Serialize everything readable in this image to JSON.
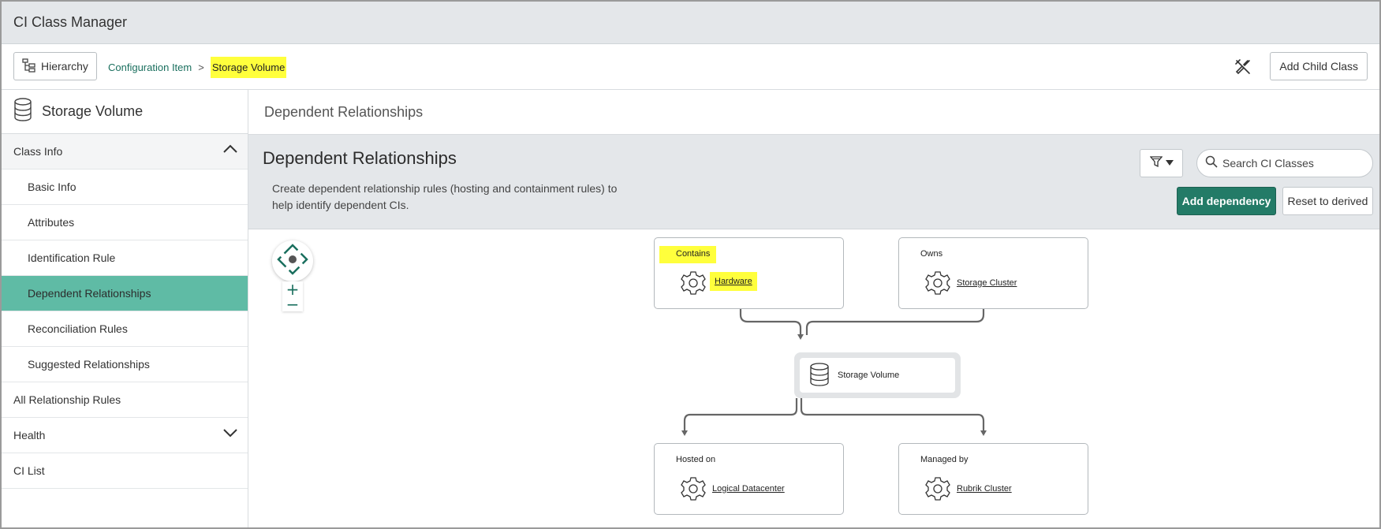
{
  "app": {
    "title": "CI Class Manager"
  },
  "toolbar": {
    "hierarchy_label": "Hierarchy",
    "breadcrumb": {
      "parent": "Configuration Item",
      "separator": ">",
      "current": "Storage Volume"
    },
    "add_child_label": "Add Child Class"
  },
  "sidebar": {
    "class_name": "Storage Volume",
    "items": [
      {
        "label": "Class Info"
      },
      {
        "label": "Basic Info"
      },
      {
        "label": "Attributes"
      },
      {
        "label": "Identification Rule"
      },
      {
        "label": "Dependent Relationships"
      },
      {
        "label": "Reconciliation Rules"
      },
      {
        "label": "Suggested Relationships"
      },
      {
        "label": "All Relationship Rules"
      },
      {
        "label": "Health"
      },
      {
        "label": "CI List"
      }
    ]
  },
  "main": {
    "page_title": "Dependent Relationships",
    "panel": {
      "title": "Dependent Relationships",
      "description": "Create dependent relationship rules (hosting and containment rules) to help identify dependent CIs.",
      "search_placeholder": "Search CI Classes",
      "add_dependency_label": "Add dependency",
      "reset_label": "Reset to derived"
    },
    "diagram": {
      "center": "Storage Volume",
      "nodes": [
        {
          "relation": "Contains",
          "target": "Hardware"
        },
        {
          "relation": "Owns",
          "target": "Storage Cluster"
        },
        {
          "relation": "Hosted on",
          "target": "Logical Datacenter"
        },
        {
          "relation": "Managed by",
          "target": "Rubrik Cluster"
        }
      ]
    }
  },
  "colors": {
    "accent": "#237b67",
    "active_nav": "#5fbba5",
    "link": "#1a6f5e",
    "highlight": "#ffff3c",
    "header_bg": "#e4e7ea"
  }
}
